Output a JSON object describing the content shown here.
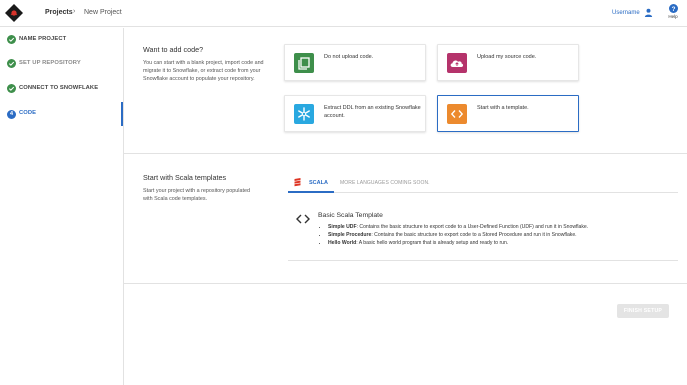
{
  "header": {
    "breadcrumb": {
      "projects": "Projects",
      "separator": "›",
      "current": "New Project"
    },
    "username": "Username",
    "help_label": "Help"
  },
  "sidebar": {
    "steps": [
      {
        "label": "NAME PROJECT",
        "state": "done"
      },
      {
        "label": "SET UP REPOSITORY",
        "state": "skipped"
      },
      {
        "label": "CONNECT TO SNOWFLAKE",
        "state": "done"
      },
      {
        "label": "CODE",
        "state": "active",
        "number": "4"
      }
    ]
  },
  "code_section": {
    "title": "Want to add code?",
    "description": "You can start with a blank project, import code and migrate it to Snowflake, or extract code from your Snowflake account to populate your repository.",
    "options": [
      {
        "label": "Do not upload code.",
        "icon": "copy-icon",
        "color": "#3e8f4b"
      },
      {
        "label": "Upload my source code.",
        "icon": "cloud-upload-icon",
        "color": "#b5336b"
      },
      {
        "label": "Extract DDL from an existing Snowflake account.",
        "icon": "snowflake-icon",
        "color": "#29a8e0"
      },
      {
        "label": "Start with a template.",
        "icon": "code-brackets-icon",
        "color": "#ec8a2e",
        "selected": true
      }
    ]
  },
  "templates_section": {
    "title": "Start with Scala templates",
    "description": "Start your project with a repository populated with Scala code templates.",
    "tabs": {
      "scala": "SCALA",
      "more": "MORE LANGUAGES COMING SOON."
    },
    "template": {
      "title": "Basic Scala Template",
      "items": [
        {
          "name": "Simple UDF",
          "text": ": Contains the basic structure to export code to a User-Defined Function (UDF) and run it in Snowflake."
        },
        {
          "name": "Simple Procedure",
          "text": ": Contains the basic structure to export code to a Stored Procedure and run it in Snowflake."
        },
        {
          "name": "Hello World",
          "text": ": A basic hello world program that is already setup and ready to run."
        }
      ]
    }
  },
  "footer": {
    "finish_label": "FINISH SETUP"
  },
  "colors": {
    "accent": "#2b6cc4",
    "done": "#3e8f4b",
    "muted": "#8a8a8a"
  }
}
